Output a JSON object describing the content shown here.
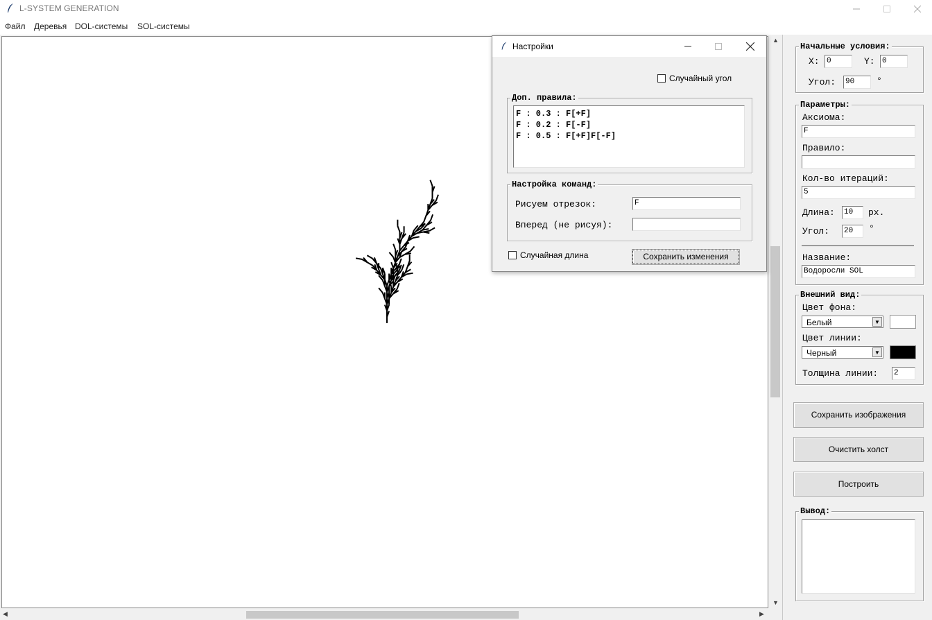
{
  "window": {
    "title": "L-SYSTEM GENERATION"
  },
  "menu": {
    "items": [
      "Файл",
      "Деревья",
      "DOL-системы",
      "SOL-системы"
    ]
  },
  "initial": {
    "legend": "Начальные условия:",
    "x_label": "X:",
    "x_value": "0",
    "y_label": "Y:",
    "y_value": "0",
    "angle_label": "Угол:",
    "angle_value": "90",
    "degree": "°"
  },
  "params": {
    "legend": "Параметры:",
    "axiom_label": "Аксиома:",
    "axiom_value": "F",
    "rule_label": "Правило:",
    "rule_value": "",
    "iterations_label": "Кол-во итераций:",
    "iterations_value": "5",
    "length_label": "Длина:",
    "length_value": "10",
    "length_unit": "px.",
    "angle_label": "Угол:",
    "angle_value": "20",
    "degree": "°",
    "name_label": "Название:",
    "name_value": "Водоросли SOL"
  },
  "appearance": {
    "legend": "Внешний вид:",
    "bg_label": "Цвет фона:",
    "bg_value": "Белый",
    "bg_color": "#ffffff",
    "line_label": "Цвет линии:",
    "line_value": "Черный",
    "line_color": "#000000",
    "thickness_label": "Толщина линии:",
    "thickness_value": "2"
  },
  "buttons": {
    "save_image": "Сохранить изображения",
    "clear": "Очистить холст",
    "build": "Построить"
  },
  "output": {
    "legend": "Вывод:"
  },
  "dialog": {
    "title": "Настройки",
    "random_angle": "Случайный угол",
    "extra_rules_legend": "Доп. правила:",
    "extra_rules": [
      "F : 0.3 : F[+F]",
      "F : 0.2 : F[-F]",
      "F : 0.5 : F[+F]F[-F]"
    ],
    "commands_legend": "Настройка команд:",
    "draw_label": "Рисуем отрезок:",
    "draw_value": "F",
    "move_label": "Вперед (не рисуя):",
    "move_value": "",
    "random_length": "Случайная длина",
    "save_button": "Сохранить изменения"
  }
}
